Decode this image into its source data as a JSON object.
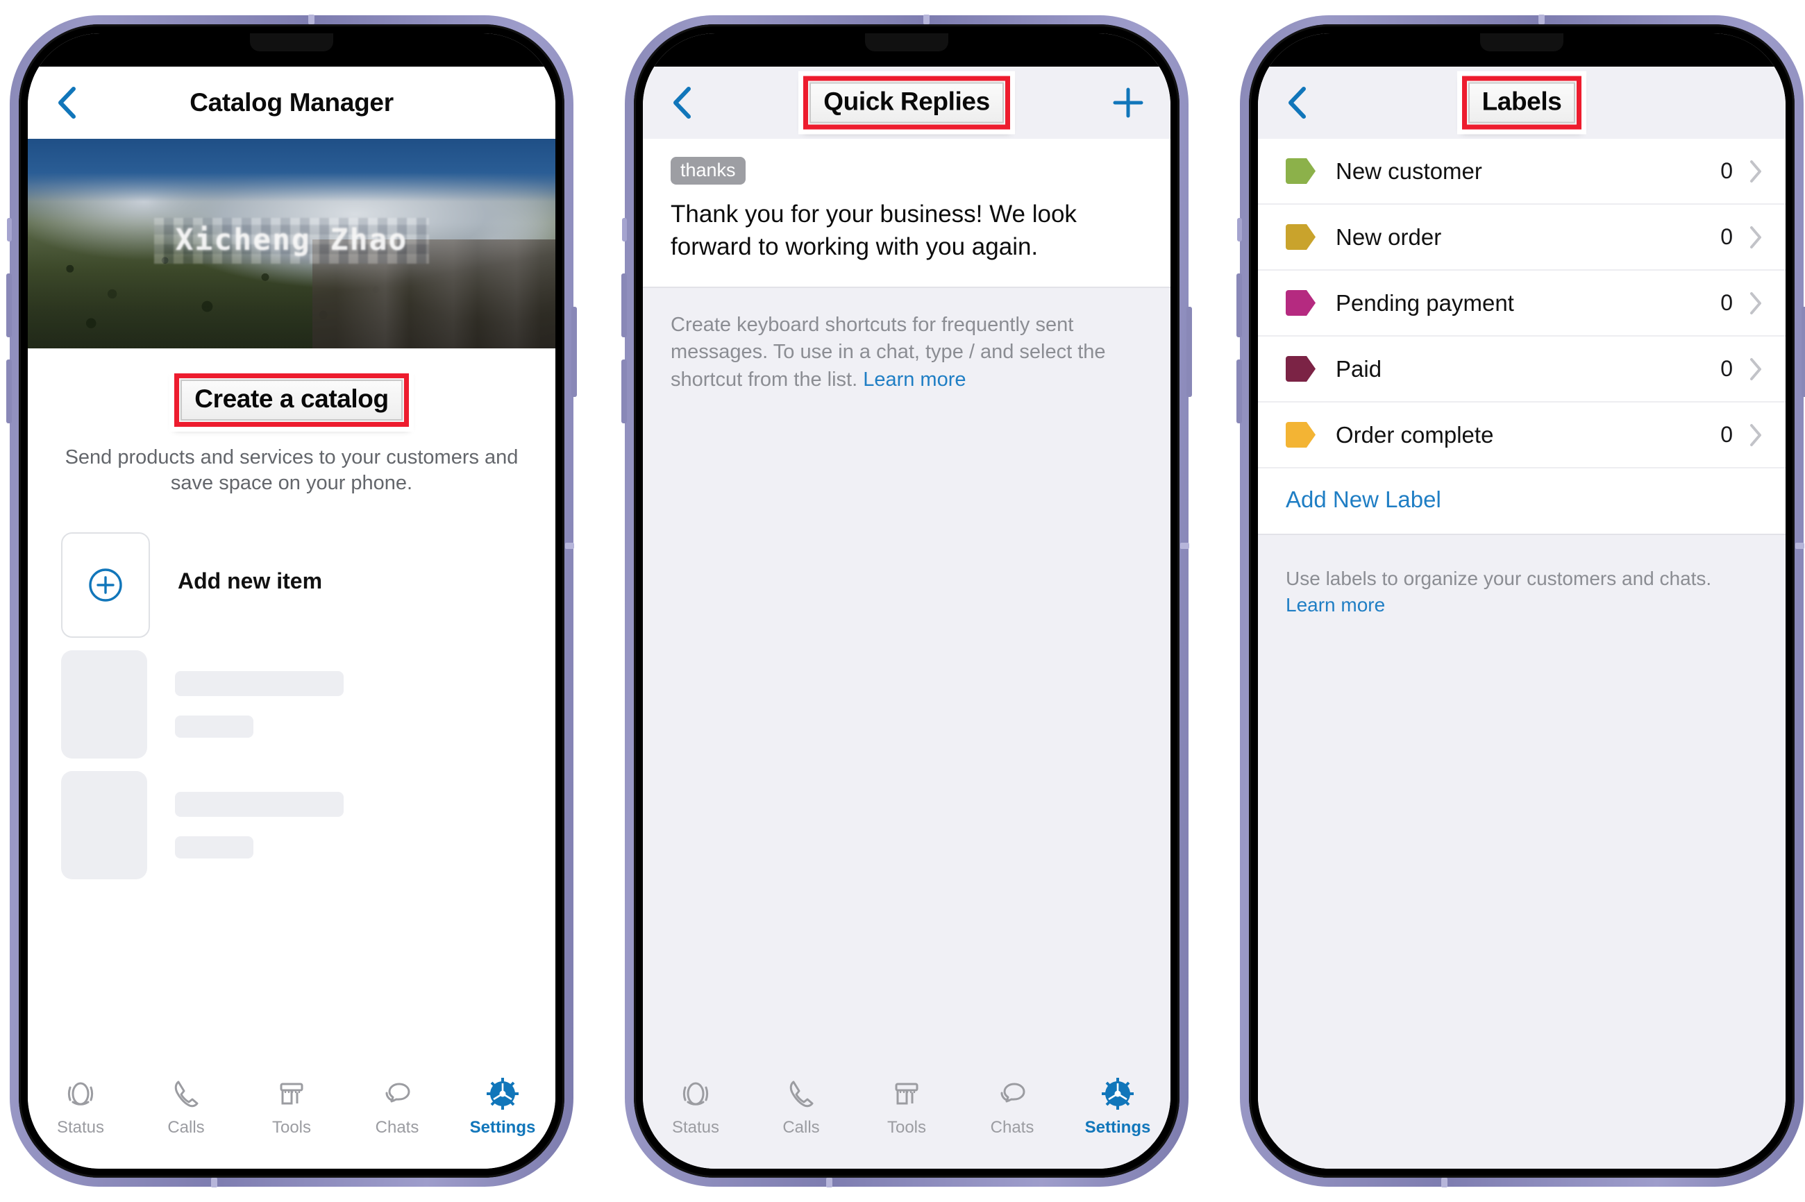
{
  "colors": {
    "accent_blue": "#1176ba",
    "link_blue": "#1f7ec4",
    "highlight_red": "#ed1c2e",
    "screen_grey": "#f0f0f5",
    "muted_text": "#8b8d93"
  },
  "phone1": {
    "nav": {
      "back_icon": "chevron-left-icon",
      "title": "Catalog Manager"
    },
    "hero": {
      "name_overlay": "Xicheng Zhao"
    },
    "cta": {
      "label": "Create a catalog",
      "highlighted": true
    },
    "subtitle": "Send products and services to your customers and save space on your phone.",
    "add_item": {
      "icon": "plus-circle-icon",
      "label": "Add new item"
    },
    "skeleton_rows": 2,
    "tabbar": {
      "items": [
        {
          "icon": "status-ring-icon",
          "label": "Status",
          "active": false
        },
        {
          "icon": "phone-icon",
          "label": "Calls",
          "active": false
        },
        {
          "icon": "storefront-icon",
          "label": "Tools",
          "active": false
        },
        {
          "icon": "chat-bubbles-icon",
          "label": "Chats",
          "active": false
        },
        {
          "icon": "gear-icon",
          "label": "Settings",
          "active": true
        }
      ]
    }
  },
  "phone2": {
    "nav": {
      "back_icon": "chevron-left-icon",
      "title": "Quick Replies",
      "highlighted": true,
      "add_icon": "plus-icon"
    },
    "quick_reply": {
      "shortcut": "thanks",
      "message": "Thank you for your business! We look forward to working with you again."
    },
    "help": {
      "text": "Create keyboard shortcuts for frequently sent messages. To use in a chat, type / and select the shortcut from the list. ",
      "link": "Learn more"
    },
    "tabbar": {
      "items": [
        {
          "icon": "status-ring-icon",
          "label": "Status",
          "active": false
        },
        {
          "icon": "phone-icon",
          "label": "Calls",
          "active": false
        },
        {
          "icon": "storefront-icon",
          "label": "Tools",
          "active": false
        },
        {
          "icon": "chat-bubbles-icon",
          "label": "Chats",
          "active": false
        },
        {
          "icon": "gear-icon",
          "label": "Settings",
          "active": true
        }
      ]
    }
  },
  "phone3": {
    "nav": {
      "back_icon": "chevron-left-icon",
      "title": "Labels",
      "highlighted": true
    },
    "labels": [
      {
        "name": "New customer",
        "count": "0",
        "color": "#8cb14a"
      },
      {
        "name": "New order",
        "count": "0",
        "color": "#c9a32c"
      },
      {
        "name": "Pending payment",
        "count": "0",
        "color": "#b52a80"
      },
      {
        "name": "Paid",
        "count": "0",
        "color": "#7b2345"
      },
      {
        "name": "Order complete",
        "count": "0",
        "color": "#f3b434"
      }
    ],
    "add_new_label": "Add New Label",
    "footer": {
      "text": "Use labels to organize your customers and chats. ",
      "link": "Learn more"
    }
  }
}
